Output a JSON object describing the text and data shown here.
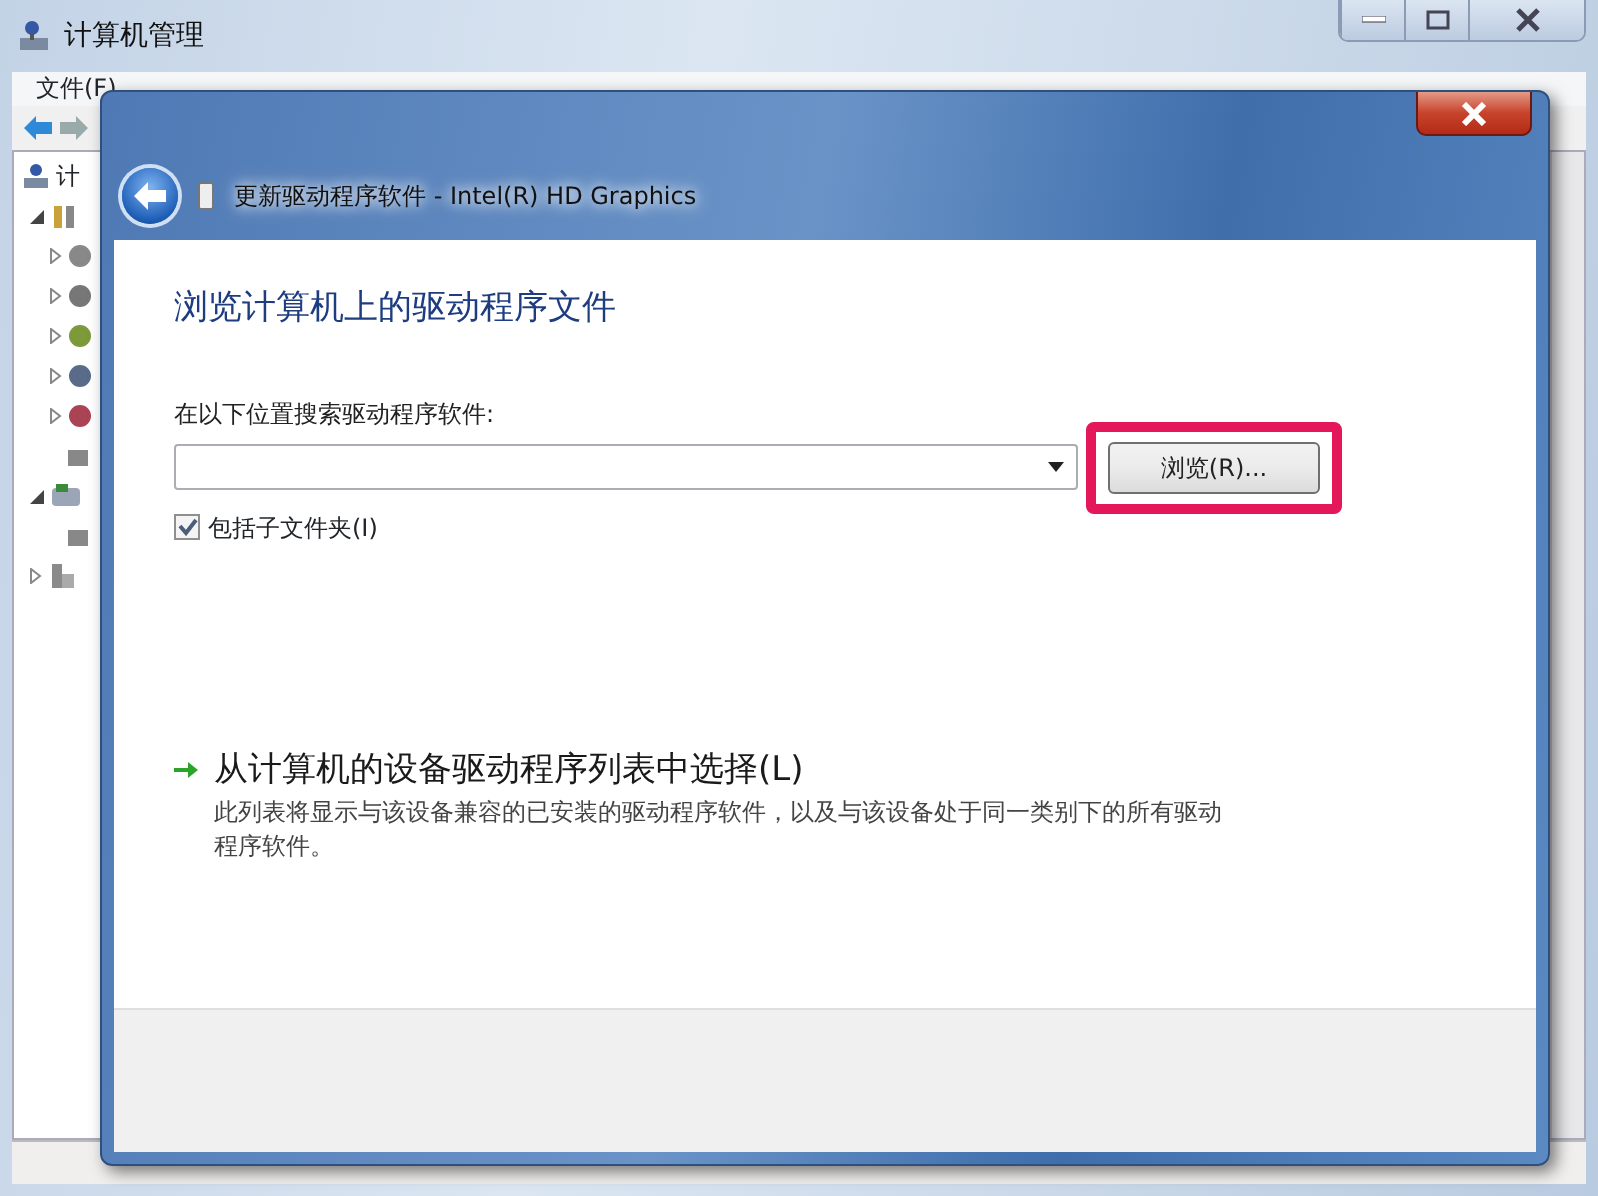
{
  "main_window": {
    "title": "计算机管理",
    "menu": [
      "文件(F)"
    ],
    "tree_root": "计"
  },
  "dialog": {
    "title": "更新驱动程序软件 - Intel(R) HD Graphics",
    "heading": "浏览计算机上的驱动程序文件",
    "location_label": "在以下位置搜索驱动程序软件:",
    "browse_button": {
      "label": "浏览(R)...",
      "highlighted": true
    },
    "include_subfolders": {
      "label": "包括子文件夹(I)",
      "checked": true
    },
    "pick_option": {
      "label": "从计算机的设备驱动程序列表中选择(L)",
      "description": "此列表将显示与该设备兼容的已安装的驱动程序软件，以及与该设备处于同一类别下的所有驱动程序软件。"
    }
  }
}
